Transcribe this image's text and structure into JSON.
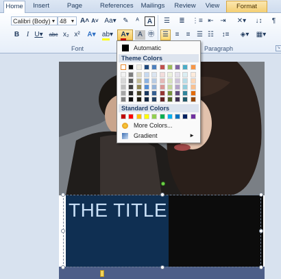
{
  "tabs": [
    "Home",
    "Insert",
    "Page Layout",
    "References",
    "Mailings",
    "Review",
    "View",
    "Format"
  ],
  "font": {
    "name": "Calibri (Body)",
    "size": "48"
  },
  "groups": {
    "font": "Font",
    "paragraph": "Paragraph"
  },
  "menu": {
    "automatic": "Automatic",
    "theme_header": "Theme Colors",
    "standard_header": "Standard Colors",
    "more_colors": "More Colors...",
    "gradient": "Gradient"
  },
  "theme_colors": [
    [
      "#ffffff",
      "#000000",
      "#eeece1",
      "#1f497d",
      "#4f81bd",
      "#c0504d",
      "#9bbb59",
      "#8064a2",
      "#4bacc6",
      "#f79646"
    ],
    [
      "#f2f2f2",
      "#7f7f7f",
      "#ddd9c3",
      "#c6d9f0",
      "#dbe5f1",
      "#f2dcdb",
      "#ebf1dd",
      "#e5e0ec",
      "#dbeef3",
      "#fdeada"
    ],
    [
      "#d8d8d8",
      "#595959",
      "#c4bd97",
      "#8db3e2",
      "#b8cce4",
      "#e5b9b7",
      "#d7e3bc",
      "#ccc1d9",
      "#b7dde8",
      "#fbd5b5"
    ],
    [
      "#bfbfbf",
      "#3f3f3f",
      "#938953",
      "#548dd4",
      "#95b3d7",
      "#d99694",
      "#c3d69b",
      "#b2a2c7",
      "#92cddc",
      "#fac08f"
    ],
    [
      "#a5a5a5",
      "#262626",
      "#494429",
      "#17365d",
      "#366092",
      "#953734",
      "#76923c",
      "#5f497a",
      "#31859b",
      "#e36c09"
    ],
    [
      "#7f7f7f",
      "#0c0c0c",
      "#1d1b10",
      "#0f243e",
      "#244061",
      "#632423",
      "#4f6128",
      "#3f3151",
      "#205867",
      "#974806"
    ]
  ],
  "standard_colors": [
    "#c00000",
    "#ff0000",
    "#ffc000",
    "#ffff00",
    "#92d050",
    "#00b050",
    "#00b0f0",
    "#0070c0",
    "#002060",
    "#7030a0"
  ],
  "document": {
    "title": "THE TITLE"
  }
}
